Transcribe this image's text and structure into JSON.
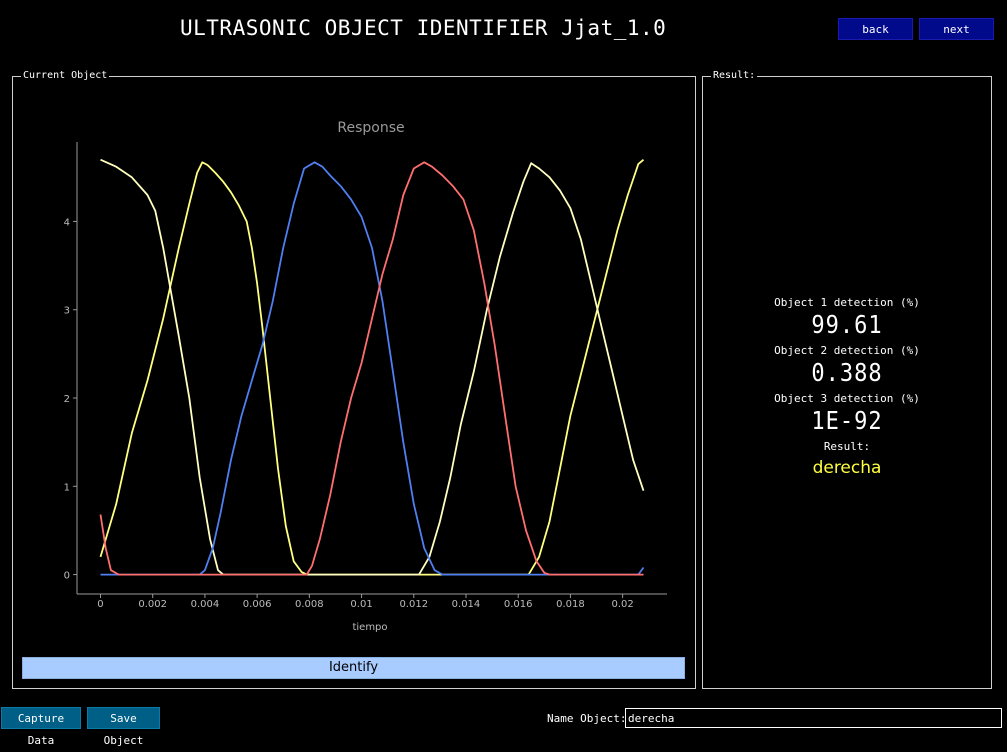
{
  "header": {
    "title": "ULTRASONIC OBJECT IDENTIFIER Jjat_1.0",
    "back_label": "back",
    "next_label": "next"
  },
  "current_object": {
    "label": "Current Object",
    "identify_label": "Identify"
  },
  "result_panel": {
    "label": "Result:",
    "obj1_label": "Object 1 detection (%)",
    "obj1_value": "99.61",
    "obj2_label": "Object 2 detection (%)",
    "obj2_value": "0.388",
    "obj3_label": "Object 3 detection (%)",
    "obj3_value": "1E-92",
    "result_label": "Result:",
    "result_value": "derecha"
  },
  "footer": {
    "capture_label": "Capture Data",
    "save_label": "Save Object",
    "name_label": "Name Object:",
    "name_value": "derecha"
  },
  "colors": {
    "yellow": "#ffff80",
    "white_yellow": "#ffffc0",
    "blue": "#4f7ff0",
    "red": "#ff6f6f",
    "button_blue": "#000a8a",
    "button_teal": "#005f87",
    "identify_bg": "#a8ccff",
    "result_text": "#ffff40"
  },
  "chart_data": {
    "type": "line",
    "title": "Response",
    "xlabel": "tiempo",
    "ylabel": "",
    "xlim": [
      -0.0009,
      0.0217
    ],
    "ylim": [
      -0.22,
      4.9
    ],
    "xticks": [
      "0",
      "0.002",
      "0.004",
      "0.006",
      "0.008",
      "0.01",
      "0.012",
      "0.014",
      "0.016",
      "0.018",
      "0.02"
    ],
    "yticks": [
      "0",
      "1",
      "2",
      "3",
      "4"
    ],
    "series": [
      {
        "color": "#ffff80",
        "x": [
          0,
          0.0006,
          0.0012,
          0.0018,
          0.0024,
          0.003,
          0.0034,
          0.0037,
          0.0039,
          0.0041,
          0.0044,
          0.0047,
          0.005,
          0.0053,
          0.0056,
          0.0058,
          0.006,
          0.0062,
          0.0065,
          0.0068,
          0.0071,
          0.0074,
          0.0077,
          0.0079,
          0.0082,
          0.009,
          0.012,
          0.015,
          0.0164,
          0.0168,
          0.0172,
          0.0176,
          0.018,
          0.0186,
          0.0192,
          0.0198,
          0.0202,
          0.0206,
          0.0208
        ],
        "y": [
          0.2,
          0.8,
          1.6,
          2.2,
          2.9,
          3.7,
          4.2,
          4.55,
          4.67,
          4.64,
          4.55,
          4.45,
          4.33,
          4.18,
          4.0,
          3.7,
          3.3,
          2.8,
          2.0,
          1.2,
          0.55,
          0.15,
          0.03,
          0.0,
          0.0,
          0.0,
          0.0,
          0.0,
          0.0,
          0.2,
          0.6,
          1.2,
          1.8,
          2.5,
          3.2,
          3.9,
          4.3,
          4.65,
          4.7
        ]
      },
      {
        "color": "#ffffc0",
        "x": [
          0,
          0.0006,
          0.0012,
          0.0018,
          0.0021,
          0.0024,
          0.0027,
          0.003,
          0.0034,
          0.0038,
          0.0042,
          0.0045,
          0.0047,
          0.005,
          0.008,
          0.011,
          0.0122,
          0.0126,
          0.013,
          0.0134,
          0.0138,
          0.0143,
          0.0148,
          0.0153,
          0.0158,
          0.0162,
          0.0165,
          0.0168,
          0.0172,
          0.0176,
          0.018,
          0.0184,
          0.0188,
          0.0192,
          0.0196,
          0.02,
          0.0204,
          0.0208
        ],
        "y": [
          4.7,
          4.62,
          4.5,
          4.3,
          4.12,
          3.7,
          3.2,
          2.7,
          2.0,
          1.1,
          0.4,
          0.05,
          0.0,
          0.0,
          0.0,
          0.0,
          0.0,
          0.2,
          0.6,
          1.1,
          1.7,
          2.3,
          3.0,
          3.6,
          4.1,
          4.45,
          4.66,
          4.6,
          4.5,
          4.35,
          4.15,
          3.8,
          3.3,
          2.8,
          2.3,
          1.8,
          1.3,
          0.95
        ]
      },
      {
        "color": "#4f7ff0",
        "x": [
          0,
          0.002,
          0.0038,
          0.004,
          0.0043,
          0.0046,
          0.005,
          0.0054,
          0.0058,
          0.0062,
          0.0066,
          0.007,
          0.0074,
          0.0078,
          0.0082,
          0.0085,
          0.0088,
          0.0092,
          0.0096,
          0.01,
          0.0104,
          0.0108,
          0.0112,
          0.0116,
          0.012,
          0.0124,
          0.0128,
          0.0131,
          0.0134,
          0.014,
          0.018,
          0.0206,
          0.0208
        ],
        "y": [
          0.0,
          0.0,
          0.0,
          0.05,
          0.3,
          0.7,
          1.3,
          1.8,
          2.2,
          2.6,
          3.1,
          3.7,
          4.2,
          4.6,
          4.67,
          4.62,
          4.52,
          4.4,
          4.25,
          4.05,
          3.7,
          3.1,
          2.3,
          1.5,
          0.8,
          0.3,
          0.05,
          0.0,
          0.0,
          0.0,
          0.0,
          0.0,
          0.08
        ]
      },
      {
        "color": "#ff6f6f",
        "x": [
          0,
          0.0002,
          0.0004,
          0.0007,
          0.003,
          0.006,
          0.0079,
          0.0081,
          0.0084,
          0.0088,
          0.0092,
          0.0096,
          0.01,
          0.0104,
          0.0108,
          0.0112,
          0.0116,
          0.012,
          0.0124,
          0.0127,
          0.0131,
          0.0135,
          0.0139,
          0.0143,
          0.0147,
          0.0151,
          0.0155,
          0.0159,
          0.0163,
          0.0167,
          0.017,
          0.0172,
          0.018,
          0.0208
        ],
        "y": [
          0.68,
          0.3,
          0.05,
          0.0,
          0.0,
          0.0,
          0.0,
          0.1,
          0.4,
          0.9,
          1.5,
          2.0,
          2.4,
          2.9,
          3.4,
          3.8,
          4.3,
          4.6,
          4.67,
          4.62,
          4.52,
          4.4,
          4.25,
          3.9,
          3.3,
          2.6,
          1.8,
          1.0,
          0.5,
          0.15,
          0.02,
          0.0,
          0.0,
          0.0
        ]
      }
    ]
  }
}
